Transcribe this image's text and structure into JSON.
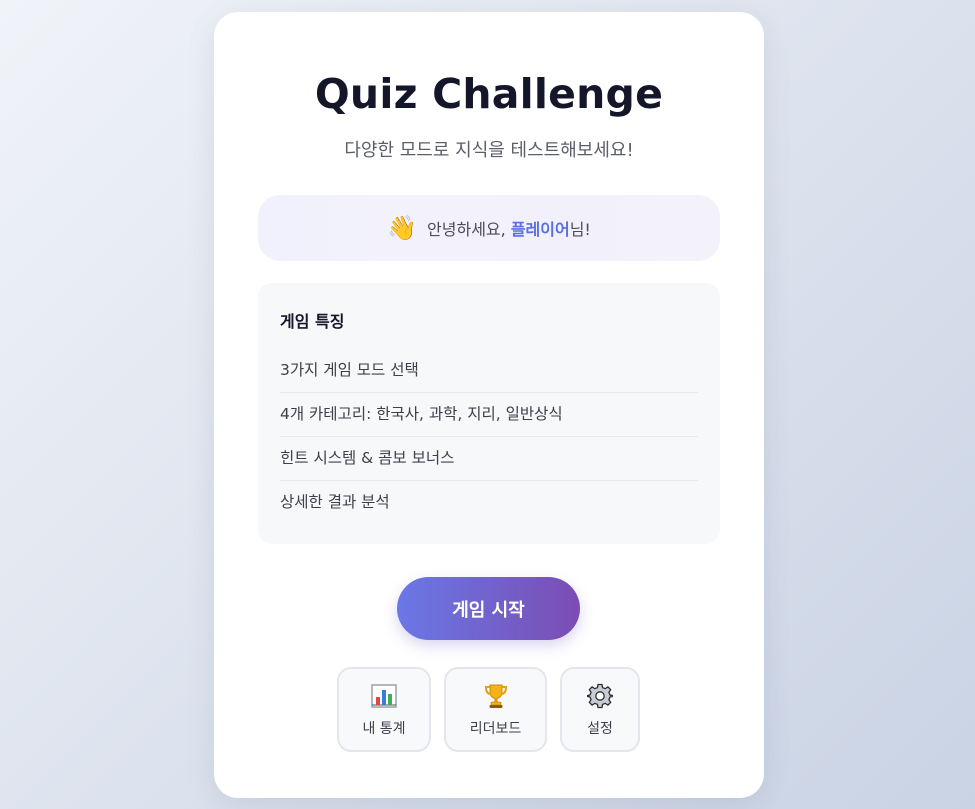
{
  "header": {
    "title": "Quiz Challenge",
    "subtitle": "다양한 모드로 지식을 테스트해보세요!"
  },
  "greeting": {
    "icon": "waving-hand-icon",
    "prefix": "안녕하세요, ",
    "name": "플레이어",
    "suffix": "님!",
    "name_color": "#5b6ee1"
  },
  "features": {
    "heading": "게임 특징",
    "items": [
      "3가지 게임 모드 선택",
      "4개 카테고리: 한국사, 과학, 지리, 일반상식",
      "힌트 시스템 & 콤보 보너스",
      "상세한 결과 분석"
    ]
  },
  "actions": {
    "start_label": "게임 시작",
    "buttons": [
      {
        "icon": "bar-chart-icon",
        "label": "내 통계"
      },
      {
        "icon": "trophy-icon",
        "label": "리더보드"
      },
      {
        "icon": "gear-icon",
        "label": "설정"
      }
    ]
  },
  "colors": {
    "accent_start": "#6a78e6",
    "accent_end": "#7b4db3"
  }
}
